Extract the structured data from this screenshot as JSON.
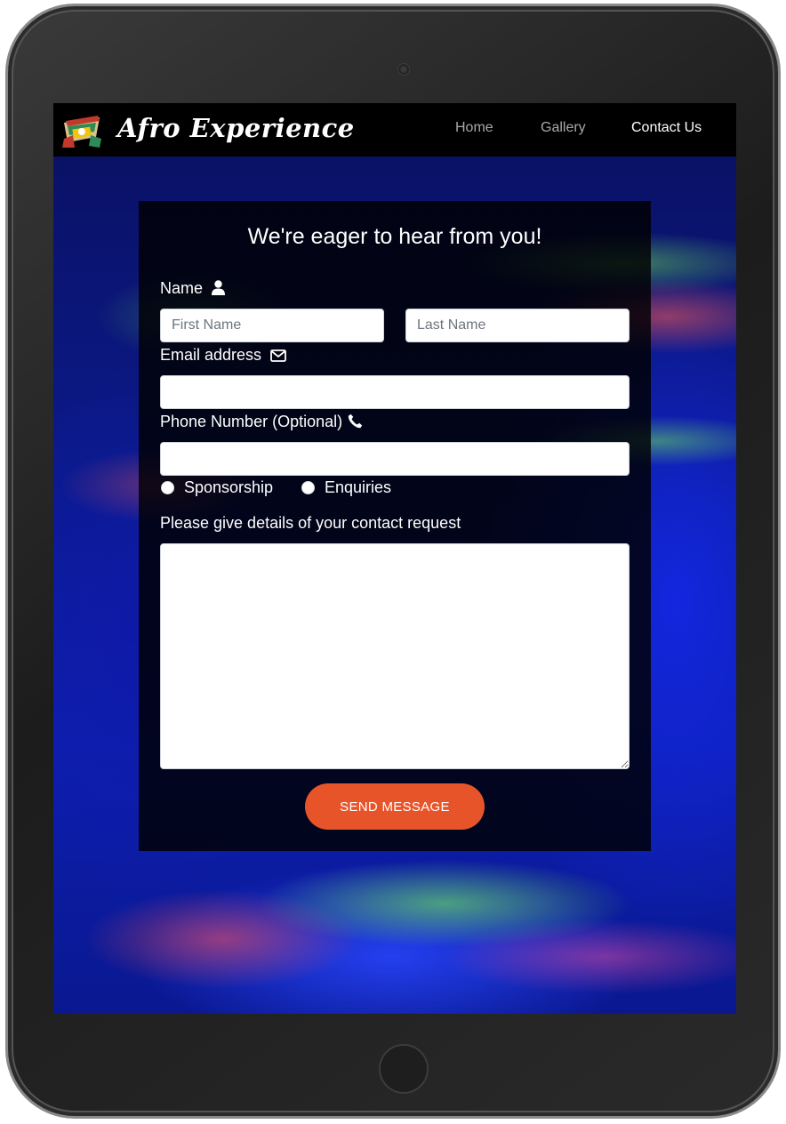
{
  "navbar": {
    "brand": "Afro Experience",
    "links": [
      {
        "label": "Home",
        "active": false
      },
      {
        "label": "Gallery",
        "active": false
      },
      {
        "label": "Contact Us",
        "active": true
      }
    ]
  },
  "form": {
    "title": "We're eager to hear from you!",
    "name_label": "Name",
    "first_name_placeholder": "First Name",
    "last_name_placeholder": "Last Name",
    "email_label": "Email address",
    "email_value": "",
    "phone_label": "Phone Number (Optional)",
    "phone_value": "",
    "radio_options": [
      "Sponsorship",
      "Enquiries"
    ],
    "details_label": "Please give details of your contact request",
    "details_value": "",
    "submit_label": "SEND MESSAGE"
  },
  "icons": {
    "name": "user-icon",
    "email": "envelope-icon",
    "phone": "phone-icon"
  },
  "colors": {
    "navbar_bg": "#000000",
    "nav_active": "#ffffff",
    "nav_inactive": "#a9a9a9",
    "button_bg": "#e8542a",
    "panel_bg": "rgba(0,0,0,0.82)"
  }
}
